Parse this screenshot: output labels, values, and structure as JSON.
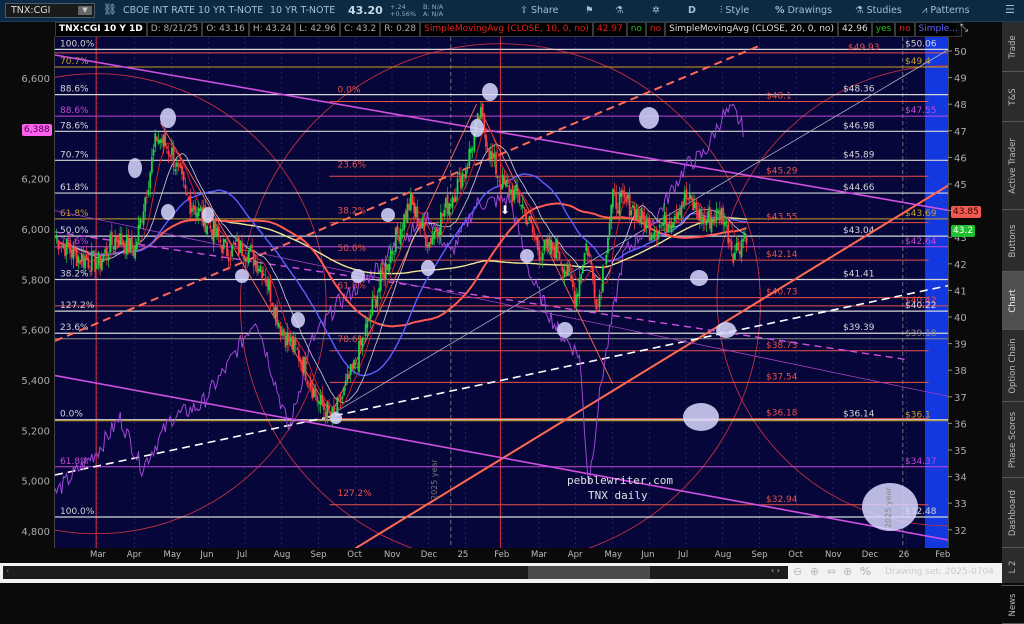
{
  "toolbar": {
    "symbol": "TNX:CGI",
    "description": "CBOE INT RATE 10 YR T-NOTE",
    "short_name": "10 YR T-NOTE",
    "last": "43.20",
    "change": "+.24",
    "change_pct": "+0.56%",
    "bid": "B: N/A",
    "ask": "A: N/A",
    "share": "Share",
    "period": "D",
    "style": "Style",
    "drawings": "Drawings",
    "studies": "Studies",
    "patterns": "Patterns"
  },
  "study_row": {
    "title": "TNX:CGI 10 Y 1D",
    "date": "D: 8/21/25",
    "open": "O: 43.16",
    "high": "H: 43.24",
    "low": "L: 42.96",
    "close": "C: 43.2",
    "range": "R: 0.28",
    "sma1": "SimpleMovingAvg (CLOSE, 10, 0, no)",
    "sma1_val": "42.97",
    "sma1_f1": "no",
    "sma1_f2": "no",
    "sma2": "SimpleMovingAvg (CLOSE, 20, 0, no)",
    "sma2_val": "42.96",
    "sma2_f1": "yes",
    "sma2_f2": "no",
    "sma3": "Simple..."
  },
  "sidebar": [
    "Trade",
    "T&S",
    "Active Trader",
    "Buttons",
    "Chart",
    "Option Chain",
    "Phase Scores",
    "Dashboard",
    "L 2",
    "News"
  ],
  "sidebar_selected": "Chart",
  "price_tags": {
    "left": "6,388",
    "right_red": "43.85",
    "right_green": "43.2"
  },
  "watermark": {
    "line1": "pebblewriter.com",
    "line2": "TNX daily",
    "year1": "2025 year",
    "year2": "2025 year"
  },
  "bottom": {
    "drawing_set": "Drawing set: 2025-0704"
  },
  "colors": {
    "white": "#d6d6d6",
    "red": "#e8504a",
    "gold": "#c8a020",
    "magenta": "#c448d8",
    "gray": "#8a8a8a",
    "chart_bg": "#06063a",
    "band": "#1338e0"
  },
  "chart_data": {
    "type": "line",
    "title": "TNX daily",
    "x_unit": "months since Mar 2024",
    "xlim": [
      -1.2,
      23.1
    ],
    "x_ticks": [
      {
        "m": 0,
        "label": "Mar"
      },
      {
        "m": 1,
        "label": "Apr"
      },
      {
        "m": 2,
        "label": "May"
      },
      {
        "m": 3,
        "label": "Jun"
      },
      {
        "m": 4,
        "label": "Jul"
      },
      {
        "m": 5,
        "label": "Aug"
      },
      {
        "m": 6,
        "label": "Sep"
      },
      {
        "m": 7,
        "label": "Oct"
      },
      {
        "m": 8,
        "label": "Nov"
      },
      {
        "m": 9,
        "label": "Dec"
      },
      {
        "m": 10,
        "label": "25"
      },
      {
        "m": 11,
        "label": "Feb"
      },
      {
        "m": 12,
        "label": "Mar"
      },
      {
        "m": 13,
        "label": "Apr"
      },
      {
        "m": 14,
        "label": "May"
      },
      {
        "m": 15,
        "label": "Jun"
      },
      {
        "m": 16,
        "label": "Jul"
      },
      {
        "m": 17,
        "label": "Aug"
      },
      {
        "m": 18,
        "label": "Sep"
      },
      {
        "m": 19,
        "label": "Oct"
      },
      {
        "m": 20,
        "label": "Nov"
      },
      {
        "m": 21,
        "label": "Dec"
      },
      {
        "m": 22,
        "label": "26"
      },
      {
        "m": 23,
        "label": "Feb"
      }
    ],
    "right_axis": {
      "range": [
        31.5,
        50.5
      ],
      "ticks": [
        32,
        33,
        34,
        35,
        36,
        37,
        38,
        39,
        40,
        41,
        42,
        43,
        44,
        45,
        46,
        47,
        48,
        49,
        50
      ]
    },
    "left_axis": {
      "range": [
        4750,
        6650
      ],
      "ticks": [
        {
          "v": 6600,
          "label": "6,600"
        },
        {
          "v": 6200,
          "label": "6,200"
        },
        {
          "v": 6000,
          "label": "6,000"
        },
        {
          "v": 5800,
          "label": "5,800"
        },
        {
          "v": 5600,
          "label": "5,600"
        },
        {
          "v": 5400,
          "label": "5,400"
        },
        {
          "v": 5200,
          "label": "5,200"
        },
        {
          "v": 5000,
          "label": "5,000"
        },
        {
          "v": 4800,
          "label": "4,800"
        }
      ]
    },
    "tnx_close": [
      [
        -1.17,
        43.0
      ],
      [
        -0.6,
        42.3
      ],
      [
        0,
        42.0
      ],
      [
        0.5,
        43.0
      ],
      [
        1,
        42.5
      ],
      [
        1.6,
        46.8
      ],
      [
        2,
        46.2
      ],
      [
        2.4,
        44.5
      ],
      [
        3,
        43.5
      ],
      [
        3.5,
        42.5
      ],
      [
        4,
        42.6
      ],
      [
        4.5,
        41.8
      ],
      [
        5,
        39.5
      ],
      [
        5.5,
        38.5
      ],
      [
        6,
        36.8
      ],
      [
        6.4,
        36.2
      ],
      [
        7,
        38.2
      ],
      [
        7.5,
        40.5
      ],
      [
        8,
        42.6
      ],
      [
        8.5,
        44.3
      ],
      [
        9,
        42.8
      ],
      [
        9.5,
        44.2
      ],
      [
        10,
        45.6
      ],
      [
        10.4,
        47.6
      ],
      [
        10.7,
        46.0
      ],
      [
        11,
        45.0
      ],
      [
        11.5,
        44.4
      ],
      [
        12,
        42.5
      ],
      [
        12.5,
        42.6
      ],
      [
        13,
        40.8
      ],
      [
        13.3,
        42.8
      ],
      [
        13.6,
        40.4
      ],
      [
        14,
        44.4
      ],
      [
        14.5,
        44.2
      ],
      [
        15,
        43.3
      ],
      [
        15.5,
        43.6
      ],
      [
        16,
        44.5
      ],
      [
        16.5,
        43.6
      ],
      [
        17,
        43.9
      ],
      [
        17.3,
        42.4
      ],
      [
        17.65,
        43.2
      ]
    ],
    "spx_close": [
      [
        -1.17,
        4950
      ],
      [
        -0.5,
        5050
      ],
      [
        0,
        5120
      ],
      [
        0.6,
        5250
      ],
      [
        1.2,
        5050
      ],
      [
        2,
        5250
      ],
      [
        2.8,
        5300
      ],
      [
        3.5,
        5450
      ],
      [
        4.3,
        5650
      ],
      [
        4.8,
        5400
      ],
      [
        5.2,
        5200
      ],
      [
        5.8,
        5550
      ],
      [
        6.5,
        5700
      ],
      [
        7.3,
        5800
      ],
      [
        8.2,
        5950
      ],
      [
        9,
        6050
      ],
      [
        9.6,
        5900
      ],
      [
        10.3,
        6100
      ],
      [
        11.2,
        6120
      ],
      [
        11.8,
        5800
      ],
      [
        12.5,
        5600
      ],
      [
        13.1,
        5500
      ],
      [
        13.35,
        4980
      ],
      [
        13.7,
        5400
      ],
      [
        14.3,
        5900
      ],
      [
        15.2,
        6050
      ],
      [
        16,
        6250
      ],
      [
        16.5,
        6300
      ],
      [
        17,
        6450
      ],
      [
        17.3,
        6470
      ],
      [
        17.6,
        6388
      ]
    ],
    "levels": [
      {
        "price": 50.06,
        "label": "$50.06",
        "color": "white",
        "group": "e",
        "fib": "100.0%"
      },
      {
        "price": 49.93,
        "label": "$49.93",
        "color": "red",
        "group": "m"
      },
      {
        "price": 49.4,
        "label": "$49.4",
        "color": "gold",
        "group": "e",
        "fib": "70.7%"
      },
      {
        "price": 48.36,
        "label": "$48.36",
        "color": "white",
        "group": "w",
        "fib": "88.6%"
      },
      {
        "price": 48.1,
        "label": "$48.1",
        "color": "red",
        "group": "r",
        "rfib": "0.0%"
      },
      {
        "price": 47.55,
        "label": "$47.55",
        "color": "magenta",
        "group": "e",
        "fib": "88.6%"
      },
      {
        "price": 46.98,
        "label": "$46.98",
        "color": "white",
        "group": "w",
        "fib": "78.6%"
      },
      {
        "price": 45.89,
        "label": "$45.89",
        "color": "white",
        "group": "w",
        "fib": "70.7%"
      },
      {
        "price": 45.29,
        "label": "$45.29",
        "color": "red",
        "group": "r",
        "rfib": "23.6%"
      },
      {
        "price": 44.66,
        "label": "$44.66",
        "color": "white",
        "group": "w",
        "fib": "61.8%"
      },
      {
        "price": 43.69,
        "label": "$43.69",
        "color": "gold",
        "group": "e",
        "fib": "61.8%"
      },
      {
        "price": 43.55,
        "label": "$43.55",
        "color": "red",
        "group": "r",
        "rfib": "38.2%"
      },
      {
        "price": 43.04,
        "label": "$43.04",
        "color": "white",
        "group": "w",
        "fib": "50.0%"
      },
      {
        "price": 42.64,
        "label": "$42.64",
        "color": "magenta",
        "group": "e",
        "fib": "78.6%"
      },
      {
        "price": 42.14,
        "label": "$42.14",
        "color": "red",
        "group": "r",
        "rfib": "50.0%"
      },
      {
        "price": 41.41,
        "label": "$41.41",
        "color": "white",
        "group": "w",
        "fib": "38.2%"
      },
      {
        "price": 40.73,
        "label": "$40.73",
        "color": "red",
        "group": "r",
        "rfib": "61.8%"
      },
      {
        "price": 40.42,
        "label": "$40.42",
        "color": "red",
        "group": "e"
      },
      {
        "price": 40.22,
        "label": "$40.22",
        "color": "white",
        "group": "e",
        "fib": "127.2%"
      },
      {
        "price": 39.39,
        "label": "$39.39",
        "color": "white",
        "group": "w",
        "fib": "23.6%"
      },
      {
        "price": 39.18,
        "label": "$39.18",
        "color": "gray",
        "group": "e"
      },
      {
        "price": 38.73,
        "label": "$38.73",
        "color": "red",
        "group": "r",
        "rfib": "78.6%"
      },
      {
        "price": 37.54,
        "label": "$37.54",
        "color": "red",
        "group": "r"
      },
      {
        "price": 36.18,
        "label": "$36.18",
        "color": "red",
        "group": "r"
      },
      {
        "price": 36.14,
        "label": "$36.14",
        "color": "white",
        "group": "w",
        "fib": "0.0%"
      },
      {
        "price": 36.1,
        "label": "$36.1",
        "color": "gold",
        "group": "e"
      },
      {
        "price": 34.37,
        "label": "$34.37",
        "color": "magenta",
        "group": "e",
        "fib": "61.8%"
      },
      {
        "price": 32.94,
        "label": "$32.94",
        "color": "red",
        "group": "r",
        "rfib": "127.2%"
      },
      {
        "price": 32.48,
        "label": "$32.48",
        "color": "white",
        "group": "e",
        "fib": "100.0%"
      }
    ],
    "trendlines": [
      {
        "from": [
          7.0,
          31.3
        ],
        "to": [
          23.2,
          45.0
        ],
        "color": "#ff6a50",
        "width": 2,
        "dash": ""
      },
      {
        "from": [
          -1.17,
          39.1
        ],
        "to": [
          18.0,
          50.2
        ],
        "color": "#ff6a50",
        "width": 2,
        "dash": "8,5"
      },
      {
        "from": [
          -1.17,
          34.06
        ],
        "to": [
          23.2,
          41.2
        ],
        "color": "#ffffff",
        "width": 1.6,
        "dash": "8,5"
      },
      {
        "from": [
          -1.17,
          49.85
        ],
        "to": [
          23.2,
          44.0
        ],
        "color": "#d050e0",
        "width": 1.6,
        "dash": ""
      },
      {
        "from": [
          -1.17,
          37.8
        ],
        "to": [
          23.2,
          31.6
        ],
        "color": "#d050e0",
        "width": 1.6,
        "dash": ""
      },
      {
        "from": [
          -1.17,
          43.2
        ],
        "to": [
          22.0,
          38.4
        ],
        "color": "#d050e0",
        "width": 1.4,
        "dash": "7,5"
      },
      {
        "from": [
          6.3,
          36.3
        ],
        "to": [
          23.2,
          50.1
        ],
        "color": "#b0b0c0",
        "width": 0.8,
        "dash": ""
      },
      {
        "from": [
          -1.17,
          44.0
        ],
        "to": [
          23.2,
          37.0
        ],
        "color": "#a040c0",
        "width": 0.8,
        "dash": ""
      },
      {
        "from": [
          1.7,
          47.3
        ],
        "to": [
          6.4,
          36.2
        ],
        "color": "#ff6a50",
        "width": 0.9,
        "dash": ""
      },
      {
        "from": [
          10.4,
          47.8
        ],
        "to": [
          14.0,
          37.5
        ],
        "color": "#ff6a50",
        "width": 0.9,
        "dash": ""
      },
      {
        "from": [
          6.3,
          36.2
        ],
        "to": [
          10.3,
          48.0
        ],
        "color": "#ff6a50",
        "width": 0.9,
        "dash": ""
      }
    ]
  }
}
